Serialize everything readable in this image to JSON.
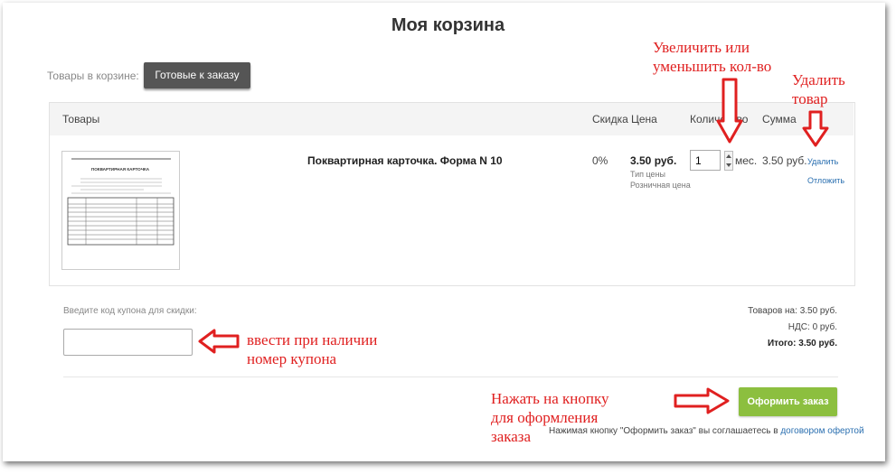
{
  "page": {
    "title": "Моя корзина"
  },
  "tabs": {
    "label": "Товары в корзине:",
    "active": "Готовые к заказу"
  },
  "table": {
    "headers": {
      "products": "Товары",
      "discount": "Скидка",
      "price": "Цена",
      "quantity": "Количество",
      "sum": "Сумма"
    }
  },
  "item": {
    "name": "Поквартирная карточка. Форма N 10",
    "discount": "0%",
    "price": "3.50 руб.",
    "price_type_label": "Тип цены",
    "price_type": "Розничная цена",
    "quantity": "1",
    "unit": "мес.",
    "sum": "3.50 руб.",
    "delete_label": "Удалить",
    "postpone_label": "Отложить",
    "thumbnail_title": "ПОКВАРТИРНАЯ КАРТОЧКА"
  },
  "coupon": {
    "label": "Введите код купона для скидки:",
    "value": ""
  },
  "totals": {
    "goods_label": "Товаров на:",
    "goods_value": "3.50 руб.",
    "vat_label": "НДС:",
    "vat_value": "0 руб.",
    "total_label": "Итого:",
    "total_value": "3.50 руб."
  },
  "checkout": {
    "button": "Оформить заказ",
    "agree_text": "Нажимая кнопку \"Оформить заказ\" вы соглашаетесь в",
    "agree_link": "договором офертой"
  },
  "annotations": {
    "qty_1": "Увеличить или",
    "qty_2": "уменьшить кол-во",
    "delete_1": "Удалить",
    "delete_2": "товар",
    "coupon_1": "ввести при наличии",
    "coupon_2": "номер купона",
    "order_1": "Нажать на кнопку",
    "order_2": "для оформления",
    "order_3": "заказа"
  },
  "colors": {
    "accent_green": "#8cbf3f",
    "dark_button": "#555555",
    "link": "#2a6fb0",
    "annotation_red": "#e02020"
  },
  "icons": [
    "spinner-arrows-icon",
    "annotation-arrow-down-icon",
    "annotation-arrow-left-icon",
    "annotation-arrow-right-icon"
  ]
}
